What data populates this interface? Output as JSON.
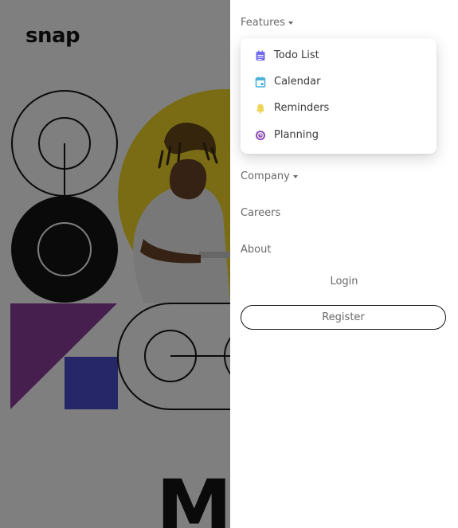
{
  "brand": {
    "logo_text": "snap"
  },
  "hero": {
    "headline_partial": "Ma"
  },
  "nav": {
    "features": {
      "label": "Features",
      "items": [
        {
          "label": "Todo List",
          "icon": "todo-list-icon",
          "color": "#726CEE"
        },
        {
          "label": "Calendar",
          "icon": "calendar-icon",
          "color": "#4BB1DA"
        },
        {
          "label": "Reminders",
          "icon": "bell-icon",
          "color": "#EDD556"
        },
        {
          "label": "Planning",
          "icon": "planning-icon",
          "color": "#8E4CB6"
        }
      ]
    },
    "company": {
      "label": "Company"
    },
    "careers": {
      "label": "Careers"
    },
    "about": {
      "label": "About"
    },
    "login": {
      "label": "Login"
    },
    "register": {
      "label": "Register"
    }
  },
  "colors": {
    "overlay": "rgba(0,0,0,0.5)",
    "hero_yellow": "#F3D92A",
    "hero_purple": "#8F3E9E",
    "hero_blue": "#4A4FD2",
    "text_gray": "#696969",
    "dark": "#141414"
  }
}
